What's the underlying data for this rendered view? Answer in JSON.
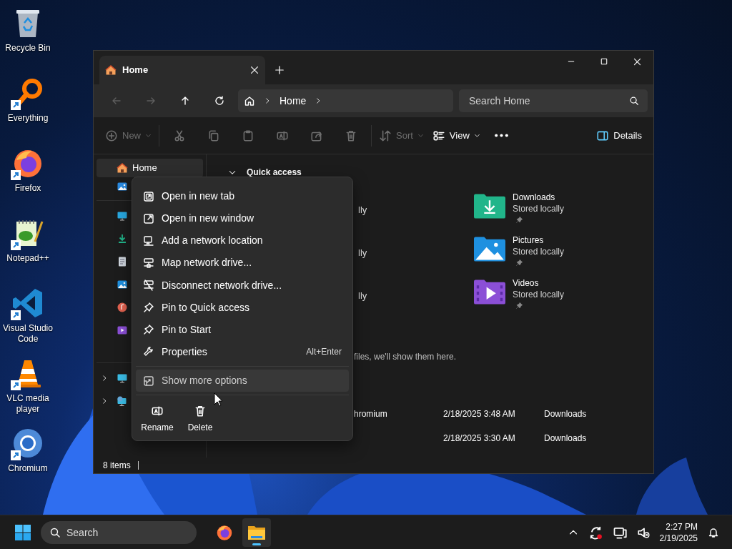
{
  "desktop_icons": [
    {
      "kind": "recycle",
      "label": "Recycle Bin",
      "shortcut": false
    },
    {
      "kind": "everything",
      "label": "Everything",
      "shortcut": true
    },
    {
      "kind": "firefox",
      "label": "Firefox",
      "shortcut": true
    },
    {
      "kind": "notepad",
      "label": "Notepad++",
      "shortcut": true
    },
    {
      "kind": "vscode",
      "label": "Visual Studio Code",
      "shortcut": true
    },
    {
      "kind": "vlc",
      "label": "VLC media player",
      "shortcut": true
    },
    {
      "kind": "chromium",
      "label": "Chromium",
      "shortcut": true
    }
  ],
  "window": {
    "tabs": [
      {
        "label": "Home",
        "selected": true
      }
    ],
    "nav_buttons": [
      {
        "kind": "back",
        "disabled": true
      },
      {
        "kind": "forward",
        "disabled": true
      },
      {
        "kind": "up",
        "disabled": false
      },
      {
        "kind": "refresh",
        "disabled": false
      }
    ],
    "breadcrumb": [
      "Home"
    ],
    "search": {
      "placeholder": "Search Home"
    },
    "toolbar": [
      {
        "kind": "new",
        "label": "New",
        "disabled": true,
        "dropdown": true
      },
      {
        "kind": "separator"
      },
      {
        "kind": "cut",
        "disabled": true
      },
      {
        "kind": "copy",
        "disabled": true
      },
      {
        "kind": "paste",
        "disabled": true
      },
      {
        "kind": "rename",
        "disabled": true
      },
      {
        "kind": "share",
        "disabled": true
      },
      {
        "kind": "delete",
        "disabled": true
      },
      {
        "kind": "separator"
      },
      {
        "kind": "sort",
        "label": "Sort",
        "disabled": true,
        "dropdown": true
      },
      {
        "kind": "view",
        "label": "View",
        "disabled": false,
        "dropdown": true
      },
      {
        "kind": "more",
        "disabled": false
      }
    ],
    "details": {
      "label": "Details"
    },
    "sidebar": {
      "top": [
        {
          "kind": "home",
          "label": "Home",
          "selected": true
        },
        {
          "kind": "gallery",
          "selected": false
        }
      ],
      "folders": [
        {
          "kind": "desktop"
        },
        {
          "kind": "downloads"
        },
        {
          "kind": "documents"
        },
        {
          "kind": "pictures"
        },
        {
          "kind": "music"
        },
        {
          "kind": "videos"
        }
      ],
      "drives": [
        {
          "kind": "pc",
          "expanded": false
        },
        {
          "kind": "network",
          "expanded": false
        }
      ]
    },
    "quick_access": {
      "title": "Quick access",
      "expanded": true,
      "partial_tiles": [
        "lly",
        "lly",
        "lly"
      ],
      "tiles": [
        {
          "kind": "downloads",
          "name": "Downloads",
          "subtitle": "Stored locally",
          "pinned": true
        },
        {
          "kind": "pictures",
          "name": "Pictures",
          "subtitle": "Stored locally",
          "pinned": true
        },
        {
          "kind": "videos",
          "name": "Videos",
          "subtitle": "Stored locally",
          "pinned": true
        }
      ]
    },
    "recent": {
      "message": "files, we'll show them here.",
      "rows": [
        {
          "name": "hromium",
          "date": "2/18/2025 3:48 AM",
          "location": "Downloads"
        },
        {
          "date": "2/18/2025 3:30 AM",
          "location": "Downloads"
        }
      ]
    },
    "status_bar": {
      "items": "8 items"
    }
  },
  "context_menu": {
    "items": [
      {
        "kind": "newtab",
        "label": "Open in new tab"
      },
      {
        "kind": "newwindow",
        "label": "Open in new window"
      },
      {
        "kind": "netloc",
        "label": "Add a network location"
      },
      {
        "kind": "mapdrive",
        "label": "Map network drive..."
      },
      {
        "kind": "disconnect",
        "label": "Disconnect network drive..."
      },
      {
        "kind": "pin",
        "label": "Pin to Quick access"
      },
      {
        "kind": "pin",
        "label": "Pin to Start"
      },
      {
        "kind": "properties",
        "label": "Properties",
        "shortcut": "Alt+Enter"
      }
    ],
    "more": {
      "label": "Show more options",
      "hovered": true
    },
    "actions": [
      {
        "kind": "rename",
        "label": "Rename"
      },
      {
        "kind": "delete",
        "label": "Delete"
      }
    ]
  },
  "taskbar": {
    "search": {
      "placeholder": "Search"
    },
    "apps": [
      {
        "kind": "firefox",
        "running": false
      },
      {
        "kind": "explorer",
        "running": true
      }
    ],
    "time": "2:27 PM",
    "date": "2/19/2025"
  }
}
